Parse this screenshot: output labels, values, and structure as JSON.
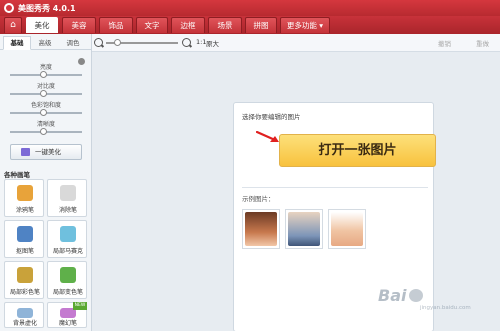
{
  "window": {
    "title": "美图秀秀 4.0.1"
  },
  "tabs": [
    {
      "label": "⌂"
    },
    {
      "label": "美化"
    },
    {
      "label": "美容"
    },
    {
      "label": "饰品"
    },
    {
      "label": "文字"
    },
    {
      "label": "边框"
    },
    {
      "label": "场景"
    },
    {
      "label": "拼图"
    },
    {
      "label": "更多功能 ▾"
    }
  ],
  "toolbar": {
    "ratio_label": "1:1",
    "original_label": "原大",
    "undo_label": "撤销",
    "redo_label": "重做"
  },
  "sidebar": {
    "subtabs": [
      "基础",
      "高级",
      "调色"
    ],
    "adjust": [
      {
        "label": "亮度"
      },
      {
        "label": "对比度"
      },
      {
        "label": "色彩饱和度"
      },
      {
        "label": "清晰度"
      }
    ],
    "oneclick_label": "一键美化",
    "section_title": "各种画笔",
    "pens": [
      {
        "label": "涂鸦笔",
        "color": "#e8a33a"
      },
      {
        "label": "消除笔",
        "color": "#d9d9d9"
      },
      {
        "label": "抠图笔",
        "color": "#4f83c4"
      },
      {
        "label": "局部马赛克",
        "color": "#6fc0de"
      },
      {
        "label": "局部彩色笔",
        "color": "#c9a23a"
      },
      {
        "label": "局部变色笔",
        "color": "#5fb04a"
      },
      {
        "label": "背景虚化",
        "color": "#8fb4d8"
      },
      {
        "label": "魔幻笔",
        "color": "#c47ad0",
        "badge": "NEW"
      }
    ]
  },
  "main": {
    "hint": "选择你要编辑的图片",
    "open_button": "打开一张图片",
    "sample_label": "示例图片：",
    "samples": [
      {
        "color": "#c8794e"
      },
      {
        "color": "#7d95b8"
      },
      {
        "color": "#f0c4a3"
      }
    ]
  },
  "watermark": {
    "text": "Bai",
    "sub": "jingyan.baidu.com"
  },
  "colors": {
    "brand": "#c8323a",
    "accent": "#f8c23e"
  }
}
